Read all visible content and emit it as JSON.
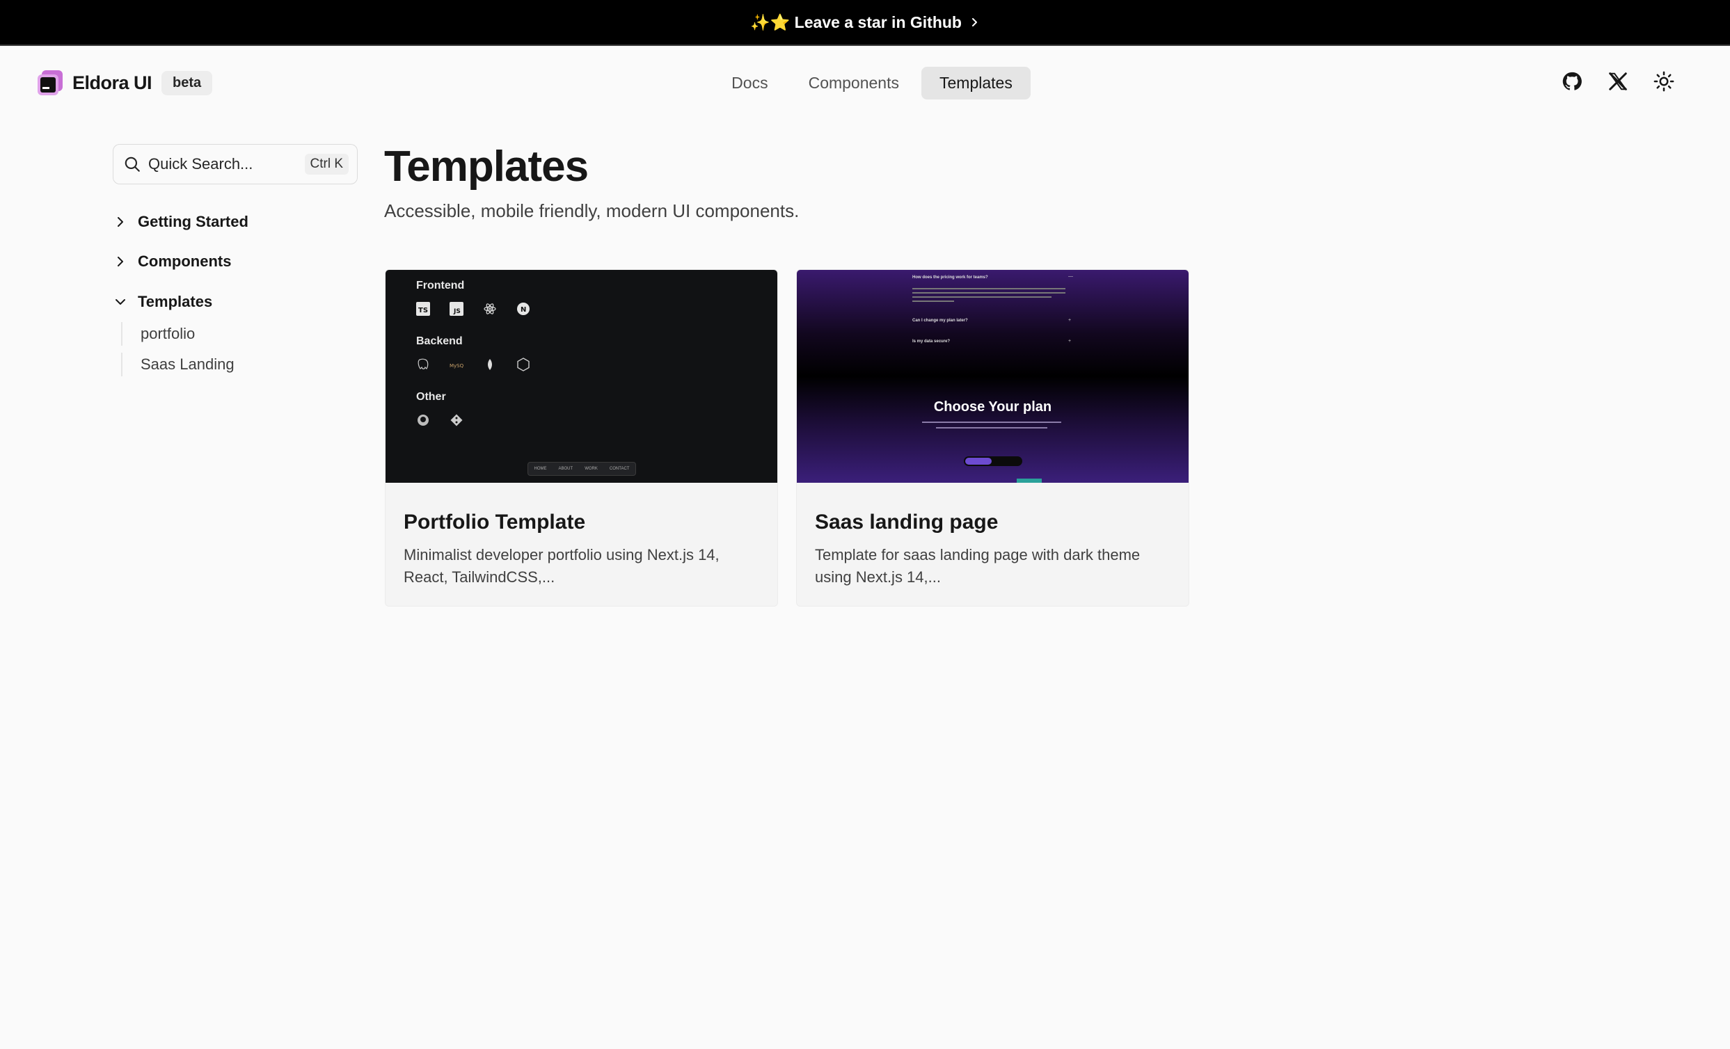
{
  "banner": {
    "text": "✨⭐ Leave a star in Github"
  },
  "header": {
    "brand": "Eldora UI",
    "badge": "beta",
    "nav": [
      {
        "label": "Docs",
        "active": false
      },
      {
        "label": "Components",
        "active": false
      },
      {
        "label": "Templates",
        "active": true
      }
    ],
    "icons": [
      "github-icon",
      "x-twitter-icon",
      "theme-toggle-sun-icon"
    ]
  },
  "sidebar": {
    "search": {
      "placeholder": "Quick Search...",
      "shortcut": "Ctrl K"
    },
    "sections": [
      {
        "label": "Getting Started",
        "expanded": false
      },
      {
        "label": "Components",
        "expanded": false
      },
      {
        "label": "Templates",
        "expanded": true
      }
    ],
    "template_items": [
      "portfolio",
      "Saas Landing"
    ]
  },
  "main": {
    "title": "Templates",
    "subtitle": "Accessible, mobile friendly, modern UI components.",
    "cards": [
      {
        "title": "Portfolio Template",
        "description": "Minimalist developer portfolio using Next.js 14, React, TailwindCSS,...",
        "preview": {
          "sections": [
            "Frontend",
            "Backend",
            "Other"
          ],
          "nav": [
            "HOME",
            "ABOUT",
            "WORK",
            "CONTACT"
          ]
        }
      },
      {
        "title": "Saas landing page",
        "description": "Template for saas landing page with dark theme using Next.js 14,...",
        "preview": {
          "faq": [
            "How does the pricing work for teams?",
            "Can I change my plan later?",
            "Is my data secure?"
          ],
          "heading": "Choose Your plan"
        }
      }
    ]
  },
  "colors": {
    "background": "#fafafa",
    "banner": "#000000",
    "accent_purple": "#6d4bd1"
  }
}
